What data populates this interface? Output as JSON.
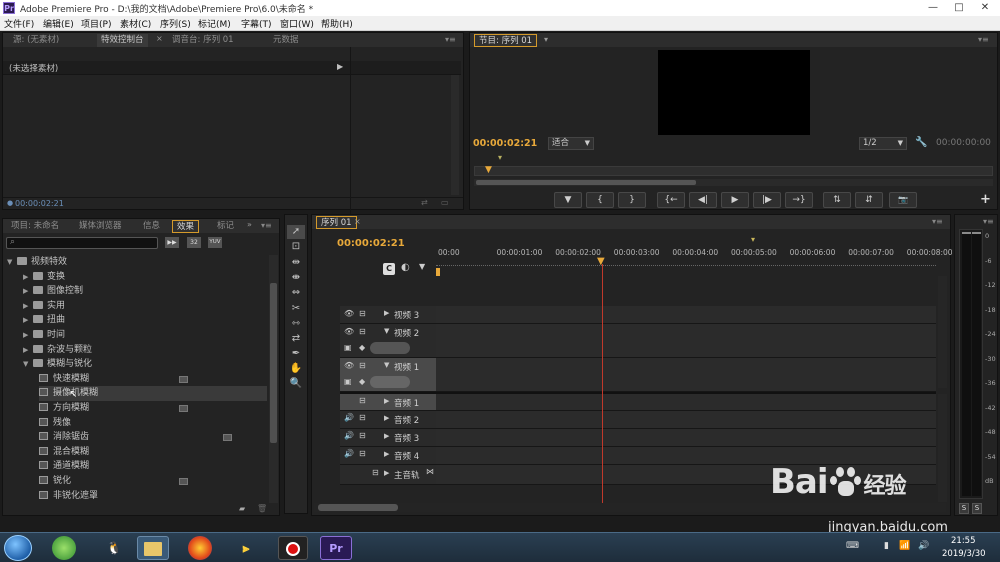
{
  "window": {
    "app_badge": "Pr",
    "title": "Adobe Premiere Pro - D:\\我的文档\\Adobe\\Premiere Pro\\6.0\\未命名 *",
    "controls": [
      "—",
      "□",
      "✕"
    ]
  },
  "menu": [
    "文件(F)",
    "编辑(E)",
    "项目(P)",
    "素材(C)",
    "序列(S)",
    "标记(M)",
    "字幕(T)",
    "窗口(W)",
    "帮助(H)"
  ],
  "source_panel": {
    "tabs": [
      "源: (无素材)",
      "特效控制台",
      "调音台: 序列 01",
      "元数据"
    ],
    "active_tab": "特效控制台",
    "tab_extra": "×",
    "no_clip": "(未选择素材)",
    "timecode": "00:00:02:21"
  },
  "program_panel": {
    "tab": "节目: 序列 01",
    "timecode": "00:00:02:21",
    "fit": "适合",
    "resolution": "1/2",
    "duration": "00:00:00:00",
    "transport": [
      "▼",
      "{",
      "}",
      "{←",
      "◀|",
      "▶",
      "|▶",
      "→}",
      "⇅",
      "⇵",
      "📷"
    ],
    "add_btn": "+"
  },
  "project_panel": {
    "tabs": [
      "项目: 未命名",
      "媒体浏览器",
      "信息",
      "效果",
      "标记"
    ],
    "active_tab": "效果",
    "toolbar_badges": [
      "▶▶",
      "32",
      "YUV"
    ],
    "tree": [
      {
        "label": "视频特效",
        "level": 0,
        "type": "folder",
        "expanded": true
      },
      {
        "label": "变换",
        "level": 1,
        "type": "folder",
        "expanded": false
      },
      {
        "label": "图像控制",
        "level": 1,
        "type": "folder",
        "expanded": false
      },
      {
        "label": "实用",
        "level": 1,
        "type": "folder",
        "expanded": false
      },
      {
        "label": "扭曲",
        "level": 1,
        "type": "folder",
        "expanded": false
      },
      {
        "label": "时间",
        "level": 1,
        "type": "folder",
        "expanded": false
      },
      {
        "label": "杂波与颗粒",
        "level": 1,
        "type": "folder",
        "expanded": false
      },
      {
        "label": "模糊与锐化",
        "level": 1,
        "type": "folder",
        "expanded": true
      },
      {
        "label": "快速模糊",
        "level": 2,
        "type": "effect",
        "accel": true
      },
      {
        "label": "摄像机模糊",
        "level": 2,
        "type": "effect",
        "hover": true
      },
      {
        "label": "方向模糊",
        "level": 2,
        "type": "effect",
        "accel": true
      },
      {
        "label": "残像",
        "level": 2,
        "type": "effect"
      },
      {
        "label": "消除锯齿",
        "level": 2,
        "type": "effect",
        "yuv": true
      },
      {
        "label": "混合模糊",
        "level": 2,
        "type": "effect"
      },
      {
        "label": "通道模糊",
        "level": 2,
        "type": "effect"
      },
      {
        "label": "锐化",
        "level": 2,
        "type": "effect",
        "accel": true
      },
      {
        "label": "非锐化遮罩",
        "level": 2,
        "type": "effect"
      }
    ]
  },
  "timeline": {
    "tab": "序列 01",
    "timecode": "00:00:02:21",
    "ruler": [
      "00:00",
      "00:00:01:00",
      "00:00:02:00",
      "00:00:03:00",
      "00:00:04:00",
      "00:00:05:00",
      "00:00:06:00",
      "00:00:07:00",
      "00:00:08:00"
    ],
    "video_tracks": [
      {
        "name": "视频 3",
        "expanded": false
      },
      {
        "name": "视频 2",
        "expanded": true
      },
      {
        "name": "视频 1",
        "expanded": true,
        "selected": true
      }
    ],
    "audio_tracks": [
      {
        "name": "音频 1",
        "selected": true
      },
      {
        "name": "音频 2"
      },
      {
        "name": "音频 3"
      },
      {
        "name": "音频 4"
      },
      {
        "name": "主音轨"
      }
    ]
  },
  "audio_meter": {
    "labels": [
      "0",
      "-6",
      "-12",
      "-18",
      "-24",
      "-30",
      "-36",
      "-42",
      "-48",
      "-54",
      "dB"
    ],
    "solo": [
      "S",
      "S"
    ]
  },
  "taskbar": {
    "clock_time": "21:55",
    "clock_date": "2019/3/30"
  },
  "watermark": {
    "brand": "Bai",
    "brand_cn": "经验",
    "url": "jingyan.baidu.com"
  },
  "colors": {
    "accent": "#e8a93a",
    "playhead": "#c0392b",
    "panel_bg": "#232323"
  }
}
